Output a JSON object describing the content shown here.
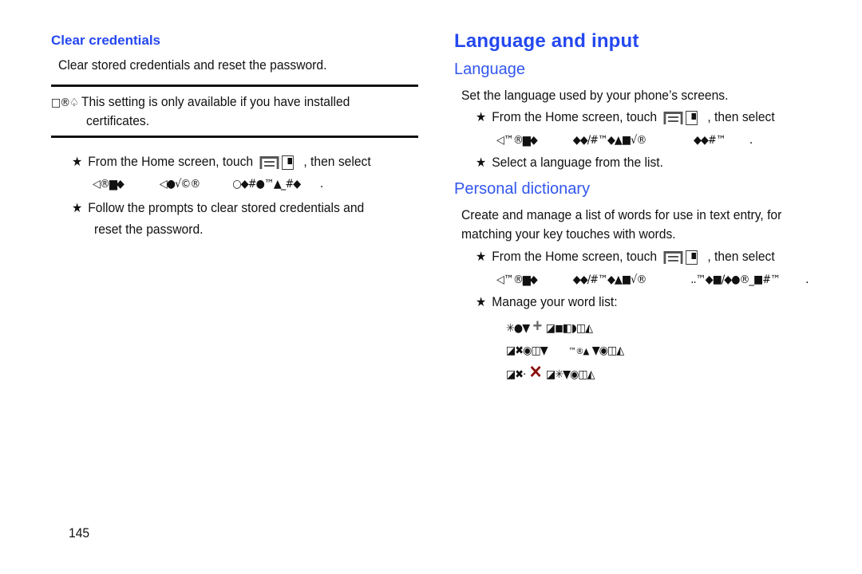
{
  "left_column": {
    "heading": "Clear credentials",
    "intro": "Clear stored credentials and reset the password.",
    "note": {
      "icon_glyph": "□®♤",
      "line1": "This setting is only available if you have installed",
      "line2": "certificates."
    },
    "steps": [
      {
        "bullet": "★",
        "line1_prefix": "From the Home screen, touch",
        "line1_suffix": ", then select",
        "line2_glyphs": [
          "◁®▆◆",
          "◁●√©®",
          "○◆#●™▲_#◆"
        ],
        "line2_end": "."
      },
      {
        "bullet": "★",
        "line1": "Follow the prompts to clear stored credentials and",
        "line2": "reset the password."
      }
    ]
  },
  "right_column": {
    "title": "Language and input",
    "sections": [
      {
        "heading": "Language",
        "intro": "Set the language used by your phone’s screens.",
        "steps": [
          {
            "bullet": "★",
            "line1_prefix": "From the Home screen, touch",
            "line1_suffix": ", then select",
            "line2_glyphs": [
              "◁™®▆◆",
              "◆◆/#™◆▲■√®",
              "◆◆#™"
            ],
            "line2_end": "."
          },
          {
            "bullet": "★",
            "line1": "Select a language from the list."
          }
        ]
      },
      {
        "heading": "Personal dictionary",
        "intro_line1": "Create and manage a list of words for use in text entry, for",
        "intro_line2": "matching your key touches with words.",
        "steps": [
          {
            "bullet": "★",
            "line1_prefix": "From the Home screen, touch",
            "line1_suffix": ", then select",
            "line2_glyphs": [
              "◁™®▆◆",
              "◆◆/#™◆▲■√®",
              "..™◆■/◆●®_■#™"
            ],
            "line2_end": "."
          },
          {
            "bullet": "★",
            "line1": "Manage your word list:"
          }
        ],
        "sub_items": [
          {
            "pre": "✳●▼",
            "icon": "plus-icon",
            "icon_glyph": "+",
            "post": "◪◼◧◗◫◭"
          },
          {
            "pre": "◪✖◉◫▼",
            "icon": "tm-icon",
            "icon_glyph": "™®▲",
            "post": "▼◉◫◭"
          },
          {
            "pre": "◪✖·",
            "icon": "x-icon",
            "icon_glyph": "✕",
            "post": "◪✳▼◉◫◭"
          }
        ]
      }
    ]
  },
  "footer": {
    "page_number": "145"
  }
}
